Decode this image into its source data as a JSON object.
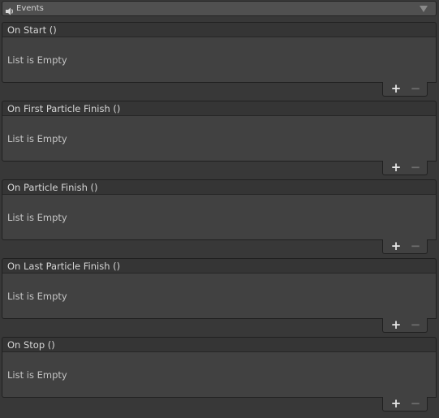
{
  "foldout": {
    "icon": "speaker-icon",
    "title": "Events",
    "chevron_icon": "chevron-down-icon"
  },
  "events": [
    {
      "label": "On Start ()",
      "empty_text": "List is Empty",
      "add_label": "+",
      "remove_label": "−"
    },
    {
      "label": "On First Particle Finish ()",
      "empty_text": "List is Empty",
      "add_label": "+",
      "remove_label": "−"
    },
    {
      "label": "On Particle Finish ()",
      "empty_text": "List is Empty",
      "add_label": "+",
      "remove_label": "−"
    },
    {
      "label": "On Last Particle Finish ()",
      "empty_text": "List is Empty",
      "add_label": "+",
      "remove_label": "−"
    },
    {
      "label": "On Stop ()",
      "empty_text": "List is Empty",
      "add_label": "+",
      "remove_label": "−"
    }
  ]
}
